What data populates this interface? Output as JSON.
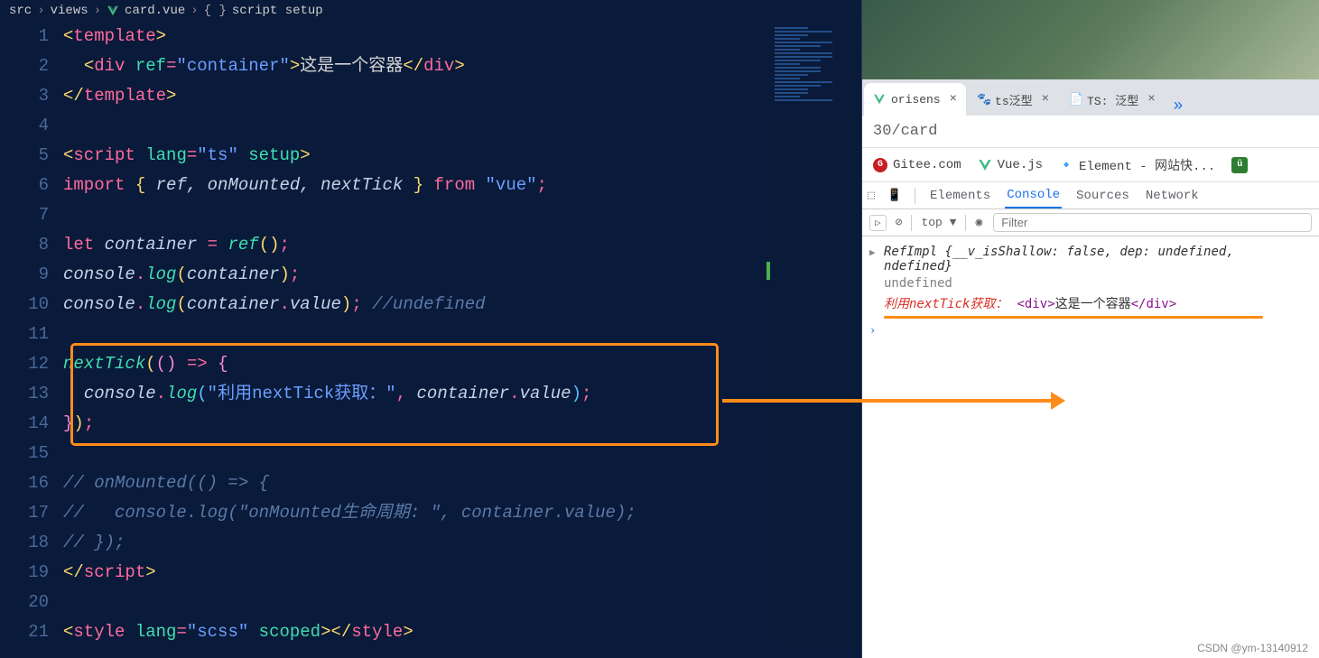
{
  "breadcrumb": {
    "p1": "src",
    "p2": "views",
    "p3": "card.vue",
    "p4": "script setup"
  },
  "code": {
    "lines": [
      "1",
      "2",
      "3",
      "4",
      "5",
      "6",
      "7",
      "8",
      "9",
      "10",
      "11",
      "12",
      "13",
      "14",
      "15",
      "16",
      "17",
      "18",
      "19",
      "20",
      "21"
    ],
    "l1_tag": "template",
    "l2_tag": "div",
    "l2_attr": "ref",
    "l2_val": "\"container\"",
    "l2_txt": "这是一个容器",
    "l5_tag": "script",
    "l5_attr1": "lang",
    "l5_val1": "\"ts\"",
    "l5_attr2": "setup",
    "l6_import": "import",
    "l6_names": "ref, onMounted, nextTick",
    "l6_from": "from",
    "l6_mod": "\"vue\"",
    "l8_let": "let",
    "l8_var": "container",
    "l8_fn": "ref",
    "l9_obj": "console",
    "l9_fn": "log",
    "l9_arg": "container",
    "l10_arg": "container",
    "l10_prop": "value",
    "l10_comment": "//undefined",
    "l12_fn": "nextTick",
    "l13_str": "\"利用nextTick获取：\"",
    "l13_arg": "container",
    "l13_prop": "value",
    "l16_comment": "// onMounted(() => {",
    "l17_comment": "//   console.log(\"onMounted生命周期: \", container.value);",
    "l18_comment": "// });",
    "l21_tag": "style",
    "l21_attr1": "lang",
    "l21_val1": "\"scss\"",
    "l21_attr2": "scoped"
  },
  "browser": {
    "tabs": [
      {
        "label": "orisens",
        "active": true
      },
      {
        "label": "ts泛型",
        "active": false
      },
      {
        "label": "TS: 泛型",
        "active": false
      }
    ],
    "url": "30/card",
    "bookmarks": {
      "gitee": "Gitee.com",
      "vue": "Vue.js",
      "element": "Element - 网站快..."
    }
  },
  "devtools": {
    "tabs": {
      "elements": "Elements",
      "console": "Console",
      "sources": "Sources",
      "network": "Network"
    },
    "toolbar": {
      "context": "top ▼",
      "filter_placeholder": "Filter"
    },
    "console": {
      "obj_type": "RefImpl",
      "obj_body": "{__v_isShallow: false, dep: undefined,",
      "obj_body2": "ndefined}",
      "undefined": "undefined",
      "msg": "利用nextTick获取：",
      "output_tag1": "<div>",
      "output_txt": "这是一个容器",
      "output_tag2": "</div>"
    }
  },
  "watermark": "CSDN @ym-13140912"
}
